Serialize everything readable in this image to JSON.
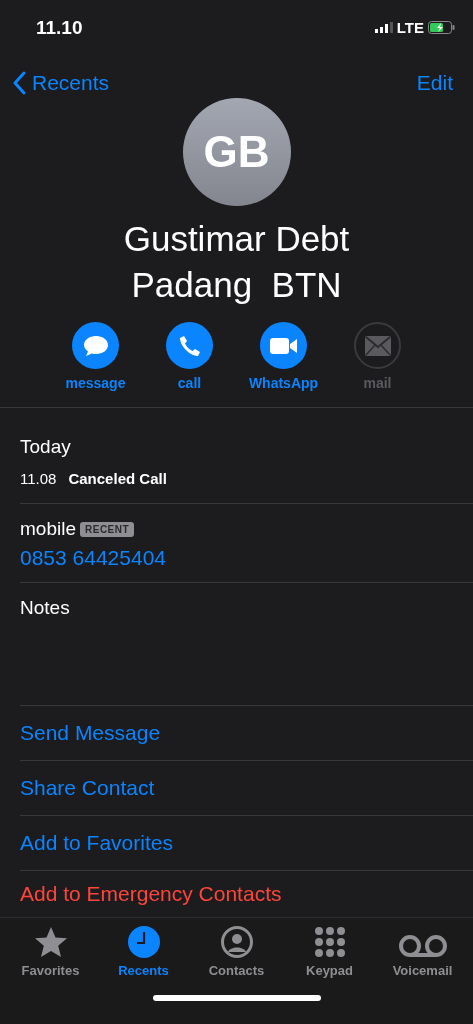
{
  "status_bar": {
    "time": "11.10",
    "network": "LTE"
  },
  "nav": {
    "back": "Recents",
    "edit": "Edit"
  },
  "contact": {
    "initials": "GB",
    "name_lines": [
      "Gustimar Debt",
      "Padang  BTN"
    ]
  },
  "actions": [
    {
      "label": "message",
      "kind": "message",
      "disabled": false
    },
    {
      "label": "call",
      "kind": "call",
      "disabled": false
    },
    {
      "label": "WhatsApp",
      "kind": "video",
      "disabled": false
    },
    {
      "label": "mail",
      "kind": "mail",
      "disabled": true
    }
  ],
  "recents": {
    "heading": "Today",
    "entries": [
      {
        "time": "11.08",
        "status": "Canceled Call"
      }
    ]
  },
  "phone": {
    "label": "mobile",
    "badge": "RECENT",
    "number": "0853 64425404"
  },
  "notes": {
    "label": "Notes"
  },
  "options": [
    {
      "label": "Send Message",
      "kind": "normal"
    },
    {
      "label": "Share Contact",
      "kind": "normal"
    },
    {
      "label": "Add to Favorites",
      "kind": "normal"
    },
    {
      "label": "Add to Emergency Contacts",
      "kind": "destructive"
    }
  ],
  "tabs": [
    {
      "label": "Favorites",
      "kind": "favorites",
      "selected": false
    },
    {
      "label": "Recents",
      "kind": "recents",
      "selected": true
    },
    {
      "label": "Contacts",
      "kind": "contacts",
      "selected": false
    },
    {
      "label": "Keypad",
      "kind": "keypad",
      "selected": false
    },
    {
      "label": "Voicemail",
      "kind": "voicemail",
      "selected": false
    }
  ]
}
